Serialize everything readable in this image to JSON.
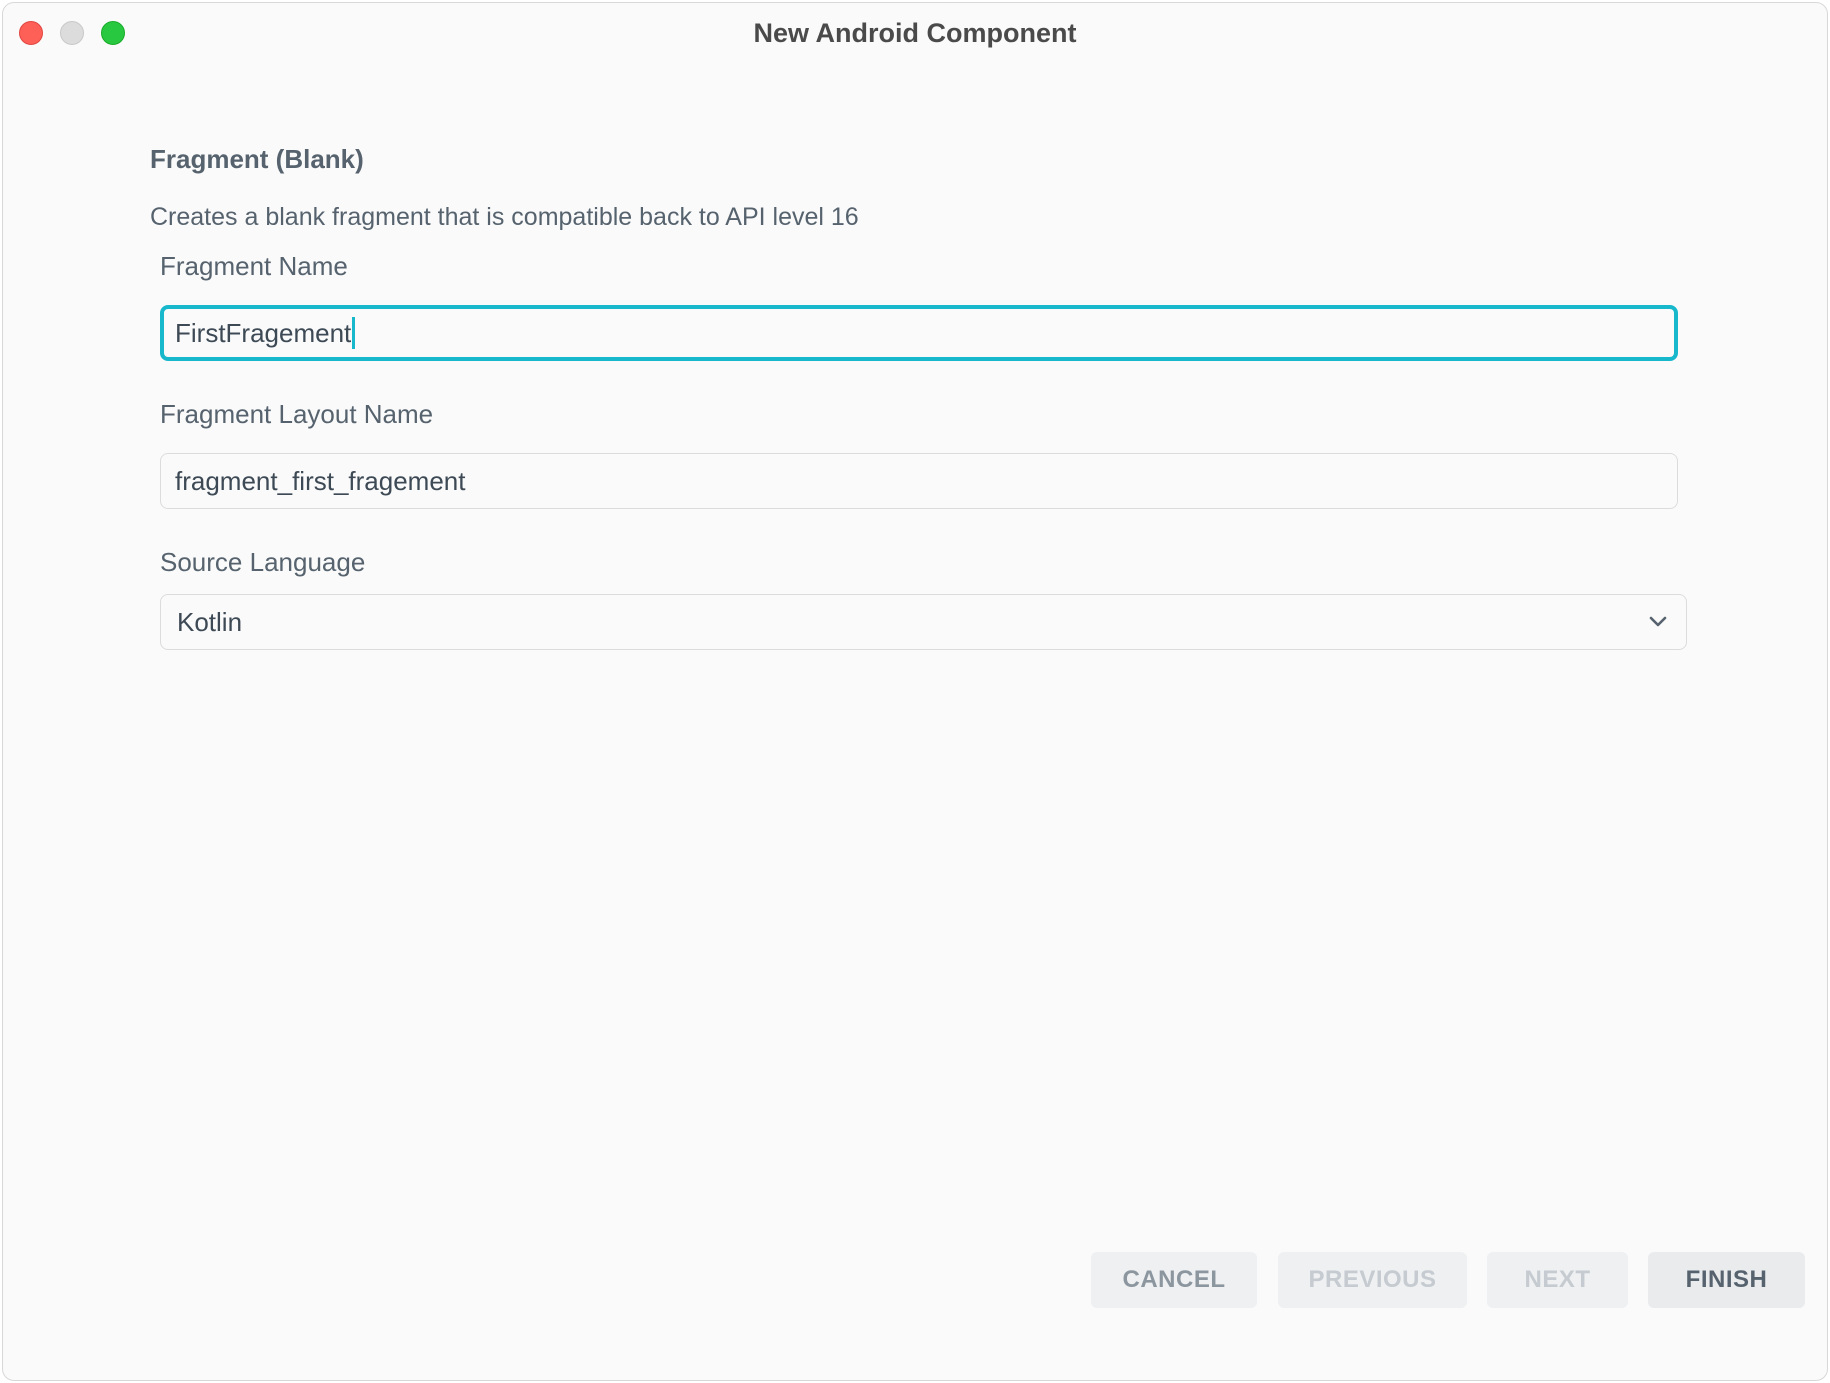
{
  "window": {
    "title": "New Android Component"
  },
  "template": {
    "heading": "Fragment (Blank)",
    "description": "Creates a blank fragment that is compatible back to API level 16"
  },
  "fields": {
    "fragment_name": {
      "label": "Fragment Name",
      "value": "FirstFragement"
    },
    "fragment_layout_name": {
      "label": "Fragment Layout Name",
      "value": "fragment_first_fragement"
    },
    "source_language": {
      "label": "Source Language",
      "value": "Kotlin"
    }
  },
  "buttons": {
    "cancel": "CANCEL",
    "previous": "PREVIOUS",
    "next": "NEXT",
    "finish": "FINISH"
  },
  "colors": {
    "focus_accent": "#18b8cc",
    "close": "#fe5f57",
    "minimize_inactive": "#dcdcdc",
    "maximize": "#28c840"
  },
  "icons": {
    "dropdown": "chevron-down-icon"
  }
}
